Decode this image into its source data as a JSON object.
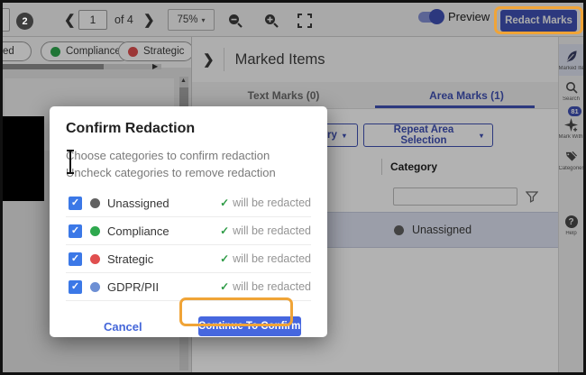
{
  "annotations": {
    "step_badge": "2"
  },
  "icons": {
    "check": "✓",
    "caret_down": "▾",
    "chevron_left": "❮",
    "chevron_right": "❯",
    "panel_chevron": "❯",
    "arrow_right_small": "▶",
    "arrow_up_small": "▲",
    "help_glyph": "?"
  },
  "toolbar": {
    "page_value": "1",
    "page_total_label": "of 4",
    "zoom_value": "75%",
    "preview_label": "Preview",
    "redact_button_label": "Redact Marks"
  },
  "viewer": {
    "chips": [
      {
        "label": "Unassigned",
        "color": "#616161"
      },
      {
        "label": "Compliance",
        "color": "#2ea84e"
      },
      {
        "label": "Strategic",
        "color": "#e04f4f"
      }
    ]
  },
  "panel": {
    "title": "Marked Items",
    "tabs": [
      {
        "label": "Text Marks (0)",
        "active": false
      },
      {
        "label": "Area Marks (1)",
        "active": true
      }
    ],
    "category_button_label": "Category",
    "repeat_button_label": "Repeat Area Selection",
    "table": {
      "column_label": "Category",
      "filter_value": "",
      "rows": [
        {
          "label": "Unassigned",
          "color": "#616161"
        }
      ]
    }
  },
  "sidebar": {
    "items": [
      {
        "label": "Marked Items",
        "icon": "feather-icon",
        "active": true
      },
      {
        "label": "Search",
        "icon": "magnifier-icon"
      },
      {
        "label": "Mark With AI",
        "icon": "ai-sparkle-icon",
        "badge": "81"
      },
      {
        "label": "Categories",
        "icon": "tags-icon"
      },
      {
        "label": "Help",
        "icon": "help-icon"
      }
    ]
  },
  "modal": {
    "title": "Confirm Redaction",
    "description_line1": "Choose categories to confirm redaction",
    "description_line2": "Uncheck categories to remove redaction",
    "rows": [
      {
        "label": "Unassigned",
        "color": "#616161",
        "checked": true,
        "status": "will be redacted"
      },
      {
        "label": "Compliance",
        "color": "#2ea84e",
        "checked": true,
        "status": "will be redacted"
      },
      {
        "label": "Strategic",
        "color": "#e04f4f",
        "checked": true,
        "status": "will be redacted"
      },
      {
        "label": "GDPR/PII",
        "color": "#6d8fd4",
        "checked": true,
        "status": "will be redacted"
      }
    ],
    "cancel_label": "Cancel",
    "confirm_label": "Continue To Confirm"
  },
  "colors": {
    "accent_indigo": "#3f51b5",
    "confirm_blue": "#4667df",
    "annotation_orange": "#f0a437",
    "checkbox_blue": "#3b78e7",
    "success_green": "#2e9b46",
    "row_highlight": "#dfe3f2",
    "dot_gray": "#616161",
    "dot_green": "#2ea84e",
    "dot_red": "#e04f4f",
    "dot_blue": "#6d8fd4"
  }
}
